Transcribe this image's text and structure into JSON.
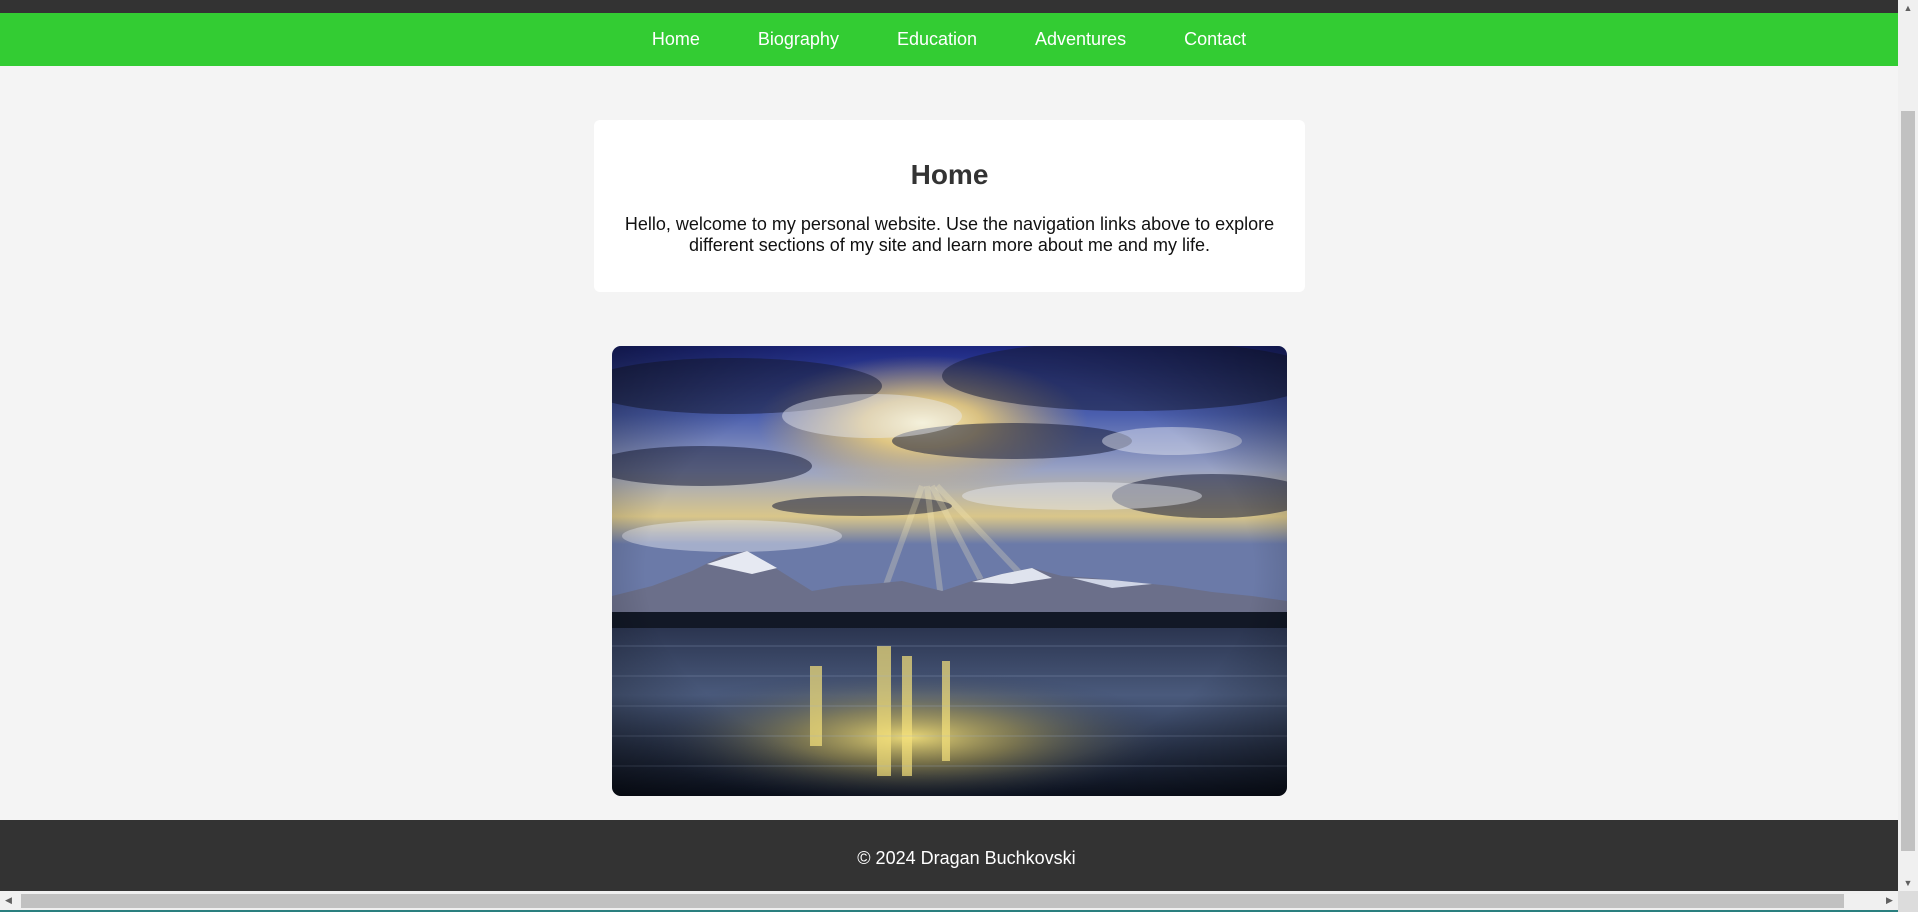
{
  "nav": {
    "items": [
      {
        "label": "Home"
      },
      {
        "label": "Biography"
      },
      {
        "label": "Education"
      },
      {
        "label": "Adventures"
      },
      {
        "label": "Contact"
      }
    ]
  },
  "main": {
    "title": "Home",
    "intro": "Hello, welcome to my personal website. Use the navigation links above to explore different sections of my site and learn more about me and my life."
  },
  "hero_image": {
    "description_icon": "landscape-photo"
  },
  "footer": {
    "text": "© 2024 Dragan Buchkovski"
  },
  "colors": {
    "nav_background": "#33cc33",
    "footer_background": "#333333",
    "page_background": "#f4f4f4"
  }
}
